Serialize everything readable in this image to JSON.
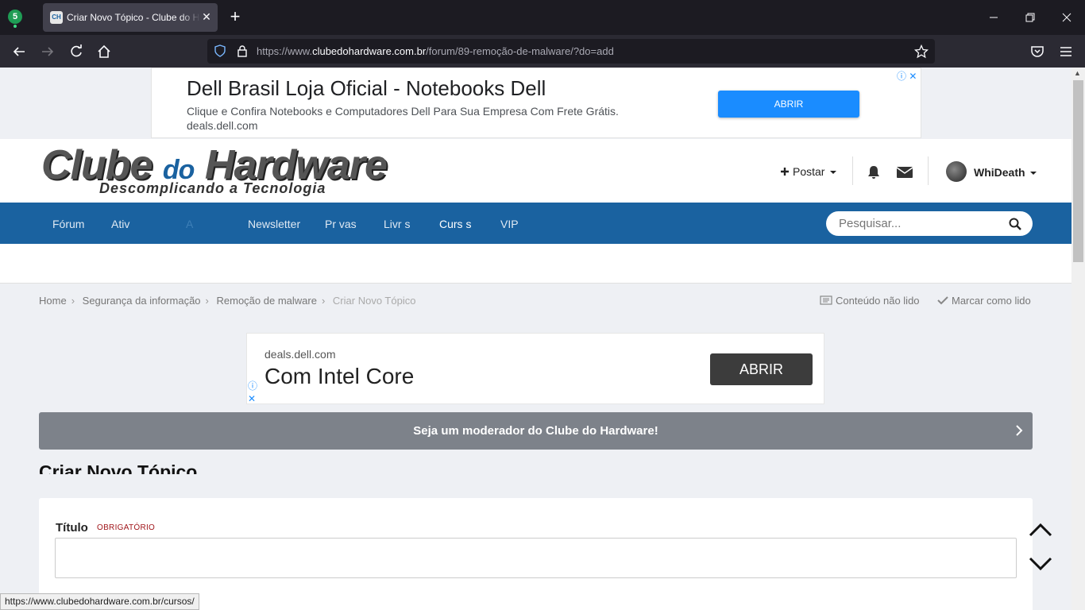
{
  "browser": {
    "extension_badge": "5",
    "tab_title": "Criar Novo Tópico - Clube do Hardware",
    "tab_favicon": "CH",
    "url_prefix": "https://www.",
    "url_domain": "clubedohardware.com.br",
    "url_path": "/forum/89-remoção-de-malware/?do=add"
  },
  "ad_top": {
    "title": "Dell Brasil Loja Oficial - Notebooks Dell",
    "description": "Clique e Confira Notebooks e Computadores Dell Para Sua Empresa Com Frete Grátis.",
    "url": "deals.dell.com",
    "button": "ABRIR"
  },
  "header": {
    "logo_part1": "Clube ",
    "logo_part2": "do",
    "logo_part3": " Hardware",
    "tagline": "Descomplicando a Tecnologia",
    "post_label": "Postar",
    "username": "WhiDeath"
  },
  "nav": {
    "items": [
      "Fórum",
      "Ativ",
      "A",
      "Newsletter",
      "Pr  vas",
      "Livr  s",
      "Curs  s",
      "VIP"
    ],
    "search_placeholder": "Pesquisar..."
  },
  "breadcrumb": {
    "items": [
      "Home",
      "Segurança da informação",
      "Remoção de malware",
      "Criar Novo Tópico"
    ],
    "unread": "Conteúdo não lido",
    "mark_read": "Marcar como lido"
  },
  "ad_second": {
    "url": "deals.dell.com",
    "title": "Com Intel Core",
    "button": "ABRIR"
  },
  "moderator_banner": "Seja um moderador do Clube do Hardware!",
  "page_title": "Criar Novo Tópico",
  "form": {
    "title_label": "Título",
    "required_label": "OBRIGATÓRIO",
    "title_value": ""
  },
  "status_url": "https://www.clubedohardware.com.br/cursos/",
  "colors": {
    "nav_blue": "#1a62a0",
    "ad_button_blue": "#1a8cff",
    "banner_gray": "#7d828a",
    "required_red": "#a0151a"
  }
}
